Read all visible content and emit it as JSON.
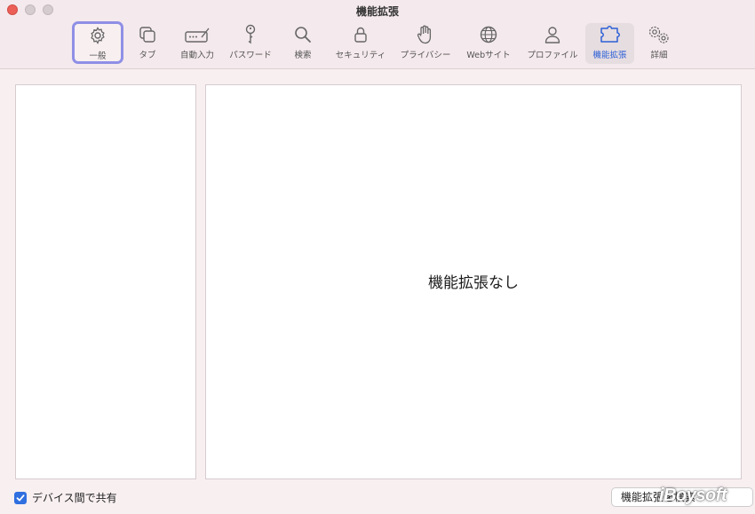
{
  "window": {
    "title": "機能拡張"
  },
  "toolbar": {
    "items": [
      {
        "label": "一般",
        "icon": "gear-icon"
      },
      {
        "label": "タブ",
        "icon": "tabs-icon"
      },
      {
        "label": "自動入力",
        "icon": "autofill-icon"
      },
      {
        "label": "パスワード",
        "icon": "key-icon"
      },
      {
        "label": "検索",
        "icon": "search-icon"
      },
      {
        "label": "セキュリティ",
        "icon": "lock-icon"
      },
      {
        "label": "プライバシー",
        "icon": "hand-icon"
      },
      {
        "label": "Webサイト",
        "icon": "globe-icon"
      },
      {
        "label": "プロファイル",
        "icon": "person-icon"
      },
      {
        "label": "機能拡張",
        "icon": "puzzle-icon"
      },
      {
        "label": "詳細",
        "icon": "gears-icon"
      }
    ],
    "selected": "機能拡張",
    "focused": "一般"
  },
  "main": {
    "empty_message": "機能拡張なし"
  },
  "footer": {
    "share_label": "デバイス間で共有",
    "share_checked": true,
    "button_label": "機能拡張を検索"
  },
  "watermark": "iBoysoft",
  "colors": {
    "accent": "#2f6fe0",
    "focus_ring": "#8f8fe6",
    "close": "#ec5f57"
  }
}
